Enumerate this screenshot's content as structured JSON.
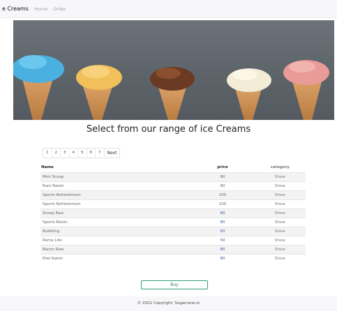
{
  "navbar": {
    "brand": "e Creams",
    "links": [
      "Home",
      "Order"
    ]
  },
  "hero": {
    "image_alt": "Five ice cream cones",
    "indicators": 3,
    "active_indicator": 1
  },
  "heading": "Select from our range of ice Creams",
  "pagination": {
    "pages": [
      "1",
      "2",
      "3",
      "4",
      "5",
      "6",
      "7"
    ],
    "next": "Next"
  },
  "table": {
    "headers": [
      "Name",
      "price",
      "category"
    ],
    "rows": [
      {
        "name": "Mint Scoop",
        "price": "90",
        "category": "Show"
      },
      {
        "name": "Rum Raisin",
        "price": "90",
        "category": "Show"
      },
      {
        "name": "Sports Refreshment",
        "price": "100",
        "category": "Show"
      },
      {
        "name": "Sports Refreshment",
        "price": "100",
        "category": "Show"
      },
      {
        "name": "Scoop Raw",
        "price": "80",
        "category": "Show"
      },
      {
        "name": "Sports Raisin",
        "price": "80",
        "category": "Show"
      },
      {
        "name": "Bubbling",
        "price": "50",
        "category": "Show"
      },
      {
        "name": "Roma Lite",
        "price": "50",
        "category": "Show"
      },
      {
        "name": "Bacon Raw",
        "price": "80",
        "category": "Show"
      },
      {
        "name": "Kiwi Raisin",
        "price": "80",
        "category": "Show"
      }
    ]
  },
  "buy_button": "Buy",
  "footer": "© 2021 Copyright: Sugarcane.in"
}
